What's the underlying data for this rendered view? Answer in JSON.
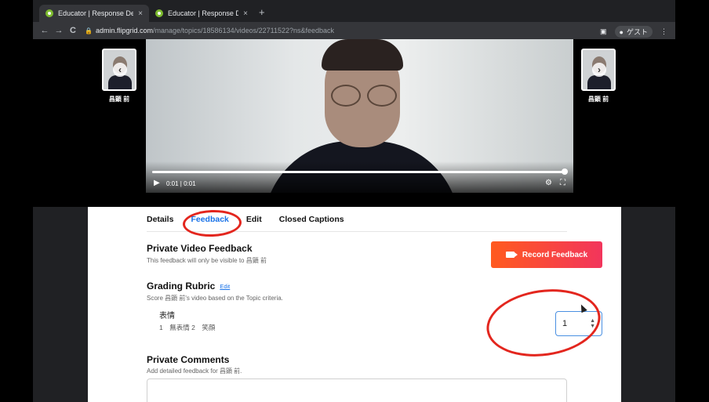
{
  "browser": {
    "tabs": [
      {
        "title": "Educator | Response Details",
        "active": true
      },
      {
        "title": "Educator | Response Details",
        "active": false
      }
    ],
    "new_tab": "+",
    "close_glyph": "×",
    "url_domain": "admin.flipgrid.com",
    "url_path": "/manage/topics/18586134/videos/22711522?ns&feedback",
    "profile_label": "ゲスト",
    "nav": {
      "back": "←",
      "forward": "→",
      "reload": "C"
    }
  },
  "video": {
    "prev_student_name": "昌顕 前",
    "next_student_name": "昌顕 前",
    "time_display": "0:01 | 0:01",
    "progress": 1.0
  },
  "tabs": [
    {
      "label": "Details",
      "active": false
    },
    {
      "label": "Feedback",
      "active": true
    },
    {
      "label": "Edit",
      "active": false
    },
    {
      "label": "Closed Captions",
      "active": false
    }
  ],
  "private_video_feedback": {
    "title": "Private Video Feedback",
    "subtitle": "This feedback will only be visible to 昌顕 前",
    "record_button": "Record Feedback"
  },
  "grading_rubric": {
    "title": "Grading Rubric",
    "edit_link": "Edit",
    "subtitle": "Score 昌顕 前's video based on the Topic criteria.",
    "criterion_name": "表情",
    "criterion_scale": "1　無表情 2　笑顔",
    "score_value": "1"
  },
  "private_comments": {
    "title": "Private Comments",
    "subtitle": "Add detailed feedback for 昌顕 前.",
    "placeholder": ""
  },
  "colors": {
    "accent": "#1a73e8",
    "record_start": "#ff5a1f",
    "record_end": "#f2355c",
    "annotation": "#e3261e"
  }
}
